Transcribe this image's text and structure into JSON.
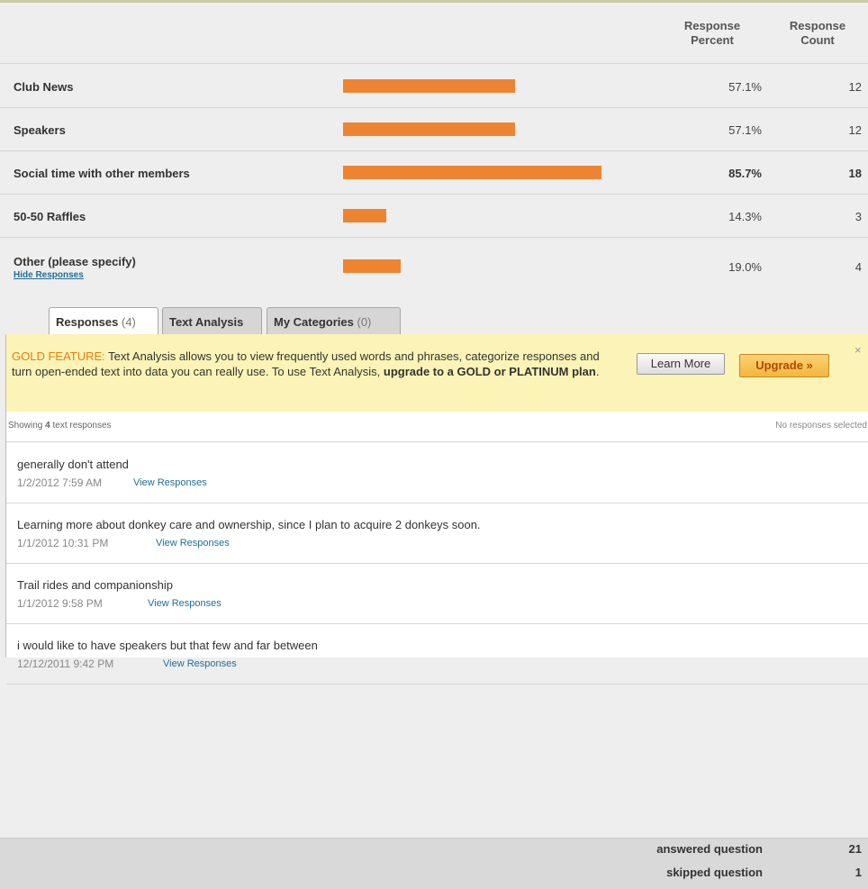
{
  "header": {
    "percent_label": "Response Percent",
    "count_label": "Response Count"
  },
  "answers": [
    {
      "label": "Club News",
      "percent": "57.1%",
      "count": "12",
      "fraction": 0.571,
      "highlight": false
    },
    {
      "label": "Speakers",
      "percent": "57.1%",
      "count": "12",
      "fraction": 0.571,
      "highlight": false
    },
    {
      "label": "Social time with other members",
      "percent": "85.7%",
      "count": "18",
      "fraction": 0.857,
      "highlight": true
    },
    {
      "label": "50-50 Raffles",
      "percent": "14.3%",
      "count": "3",
      "fraction": 0.143,
      "highlight": false
    },
    {
      "label": "Other (please specify)",
      "percent": "19.0%",
      "count": "4",
      "fraction": 0.19,
      "highlight": false
    }
  ],
  "bar_color": "#ee8432",
  "hide_link": "Hide Responses",
  "tabs": [
    {
      "label": "Responses",
      "count": "(4)",
      "active": true
    },
    {
      "label": "Text Analysis",
      "count": "",
      "active": false
    },
    {
      "label": "My Categories",
      "count": "(0)",
      "active": false
    }
  ],
  "gold": {
    "title": "GOLD FEATURE:",
    "body": " Text Analysis allows you to view frequently used words and phrases, categorize responses and turn open-ended text into data you can really use. To use Text Analysis, ",
    "emph": "upgrade to a GOLD or PLATINUM plan",
    "end": ".",
    "learn_more": "Learn More",
    "upgrade": "Upgrade »",
    "close_icon": "×"
  },
  "showing": {
    "prefix": "Showing ",
    "count": "4",
    "suffix": " text responses",
    "selected": "No responses selected"
  },
  "responses": [
    {
      "text": "generally don't attend",
      "date": "1/2/2012 7:59 AM",
      "link": "View Responses"
    },
    {
      "text": "Learning more about donkey care and ownership, since I plan to acquire 2 donkeys soon.",
      "date": "1/1/2012 10:31 PM",
      "link": "View Responses"
    },
    {
      "text": "Trail rides and companionship",
      "date": "1/1/2012 9:58 PM",
      "link": "View Responses"
    },
    {
      "text": "i would like to have speakers but that few and far between",
      "date": "12/12/2011 9:42 PM",
      "link": "View Responses"
    }
  ],
  "footer": {
    "answered_label": "answered question",
    "answered_value": "21",
    "skipped_label": "skipped question",
    "skipped_value": "1"
  }
}
